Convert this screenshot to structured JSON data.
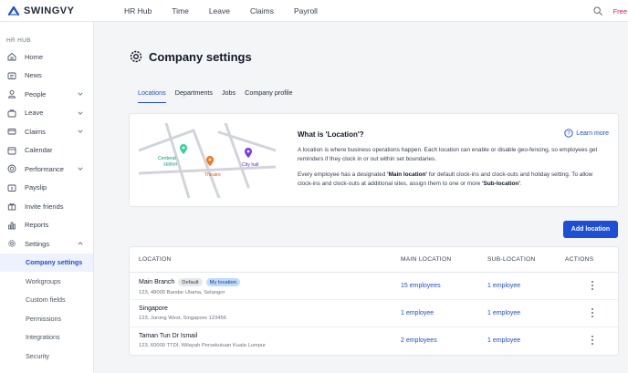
{
  "brand": {
    "name": "SWINGVY",
    "color": "#1d4ed8"
  },
  "topnav": {
    "items": [
      "HR Hub",
      "Time",
      "Leave",
      "Claims",
      "Payroll"
    ],
    "plan_label": "Free"
  },
  "sidebar": {
    "heading": "HR HUB",
    "items": [
      {
        "label": "Home",
        "icon": "home-icon"
      },
      {
        "label": "News",
        "icon": "news-icon"
      },
      {
        "label": "People",
        "icon": "person-icon"
      },
      {
        "label": "Leave",
        "icon": "briefcase-icon"
      },
      {
        "label": "Claims",
        "icon": "claims-icon"
      },
      {
        "label": "Calendar",
        "icon": "calendar-icon"
      },
      {
        "label": "Performance",
        "icon": "target-icon"
      },
      {
        "label": "Payslip",
        "icon": "payslip-icon"
      },
      {
        "label": "Invite friends",
        "icon": "gift-icon"
      },
      {
        "label": "Reports",
        "icon": "chart-icon"
      },
      {
        "label": "Settings",
        "icon": "gear-icon"
      }
    ],
    "subitems": [
      "Company settings",
      "Workgroups",
      "Custom fields",
      "Permissions",
      "Integrations",
      "Security"
    ]
  },
  "page": {
    "title": "Company settings",
    "tabs": [
      "Locations",
      "Departments",
      "Jobs",
      "Company profile"
    ]
  },
  "info": {
    "title": "What is 'Location'?",
    "learn_more": "Learn more",
    "para1": "A location is where business operations happen. Each location can enable or disable geo-fencing, so employees get reminders if they clock in or out within set boundaries.",
    "para2_pre": "Every employee has a designated ",
    "para2_main": "'Main location'",
    "para2_mid": " for default clock-ins and clock-outs and holiday setting. To allow clock-ins and clock-outs at additional sites, assign them to one or more ",
    "para2_sub": "'Sub-location'",
    "para2_end": ".",
    "map_labels": {
      "station": "Centeral station",
      "theatre": "Theatre",
      "cityhall": "City hall"
    }
  },
  "add_location_label": "Add location",
  "table": {
    "headers": {
      "location": "LOCATION",
      "main": "MAIN LOCATION",
      "sub": "SUB-LOCATION",
      "actions": "ACTIONS"
    },
    "badges": {
      "default": "Default",
      "mine": "My location"
    },
    "rows": [
      {
        "name": "Main Branch",
        "address": "123, 48000 Bandar Utama, Selangor",
        "main": "15 employees",
        "sub": "1 employee"
      },
      {
        "name": "Singapore",
        "address": "123, Jurong West, Singapore 123456",
        "main": "1 employee",
        "sub": "1 employee"
      },
      {
        "name": "Taman Tun Dr Ismail",
        "address": "123, 60000 TTDI, Wilayah Persekutuan Kuala Lumpur",
        "main": "2 employees",
        "sub": "1 employee"
      }
    ]
  }
}
